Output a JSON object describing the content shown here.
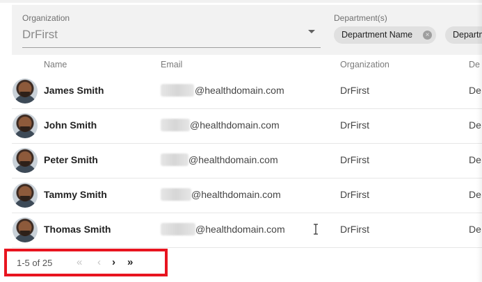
{
  "filters": {
    "organization": {
      "label": "Organization",
      "value": "DrFirst"
    },
    "departments": {
      "label": "Department(s)",
      "chips": [
        {
          "label": "Department Name",
          "remove_icon": "×"
        },
        {
          "label": "Departm"
        }
      ]
    }
  },
  "table": {
    "columns": [
      "Name",
      "Email",
      "Organization",
      "De"
    ],
    "rows": [
      {
        "name": "James Smith",
        "email_domain": "@healthdomain.com",
        "organization": "DrFirst",
        "department": "De"
      },
      {
        "name": "John Smith",
        "email_domain": "@healthdomain.com",
        "organization": "DrFirst",
        "department": "De"
      },
      {
        "name": "Peter Smith",
        "email_domain": "@healthdomain.com",
        "organization": "DrFirst",
        "department": "De"
      },
      {
        "name": "Tammy Smith",
        "email_domain": "@healthdomain.com",
        "organization": "DrFirst",
        "department": "De"
      },
      {
        "name": "Thomas Smith",
        "email_domain": "@healthdomain.com",
        "organization": "DrFirst",
        "department": "De"
      }
    ]
  },
  "pagination": {
    "range_text": "1-5 of 25",
    "first_icon": "«",
    "prev_icon": "‹",
    "next_icon": "›",
    "last_icon": "»"
  },
  "colors": {
    "highlight_border": "#e8141f",
    "filter_background": "#f2f2f2",
    "chip_background": "#e0e0e0"
  },
  "icons": [
    "dropdown-arrow-icon",
    "chip-remove-icon",
    "avatar",
    "text-cursor-icon",
    "first-page-icon",
    "previous-page-icon",
    "next-page-icon",
    "last-page-icon"
  ]
}
